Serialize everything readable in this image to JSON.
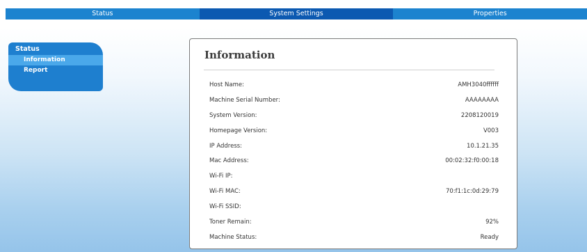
{
  "nav": {
    "tabs": [
      {
        "label": "Status"
      },
      {
        "label": "System Settings"
      },
      {
        "label": "Properties"
      }
    ]
  },
  "sidebar": {
    "title": "Status",
    "items": [
      {
        "label": "Information",
        "active": true
      },
      {
        "label": "Report",
        "active": false
      }
    ]
  },
  "panel": {
    "title": "Information",
    "rows": [
      {
        "key": "Host Name:",
        "value": "AMH3040ffffff"
      },
      {
        "key": "Machine Serial Number:",
        "value": "AAAAAAAA"
      },
      {
        "key": "System Version:",
        "value": "2208120019"
      },
      {
        "key": "Homepage Version:",
        "value": "V003"
      },
      {
        "key": "IP Address:",
        "value": "10.1.21.35"
      },
      {
        "key": "Mac Address:",
        "value": "00:02:32:f0:00:18"
      },
      {
        "key": "Wi-Fi IP:",
        "value": ""
      },
      {
        "key": "Wi-Fi MAC:",
        "value": "70:f1:1c:0d:29:79"
      },
      {
        "key": "Wi-Fi SSID:",
        "value": ""
      },
      {
        "key": "Toner Remain:",
        "value": "92%"
      },
      {
        "key": "Machine Status:",
        "value": "Ready"
      }
    ]
  },
  "colors": {
    "nav_tab": "#1c83cf",
    "nav_tab_active": "#0c59b1",
    "sidebar_bg": "#1e7fcf",
    "sidebar_active": "#4aa8ea"
  }
}
